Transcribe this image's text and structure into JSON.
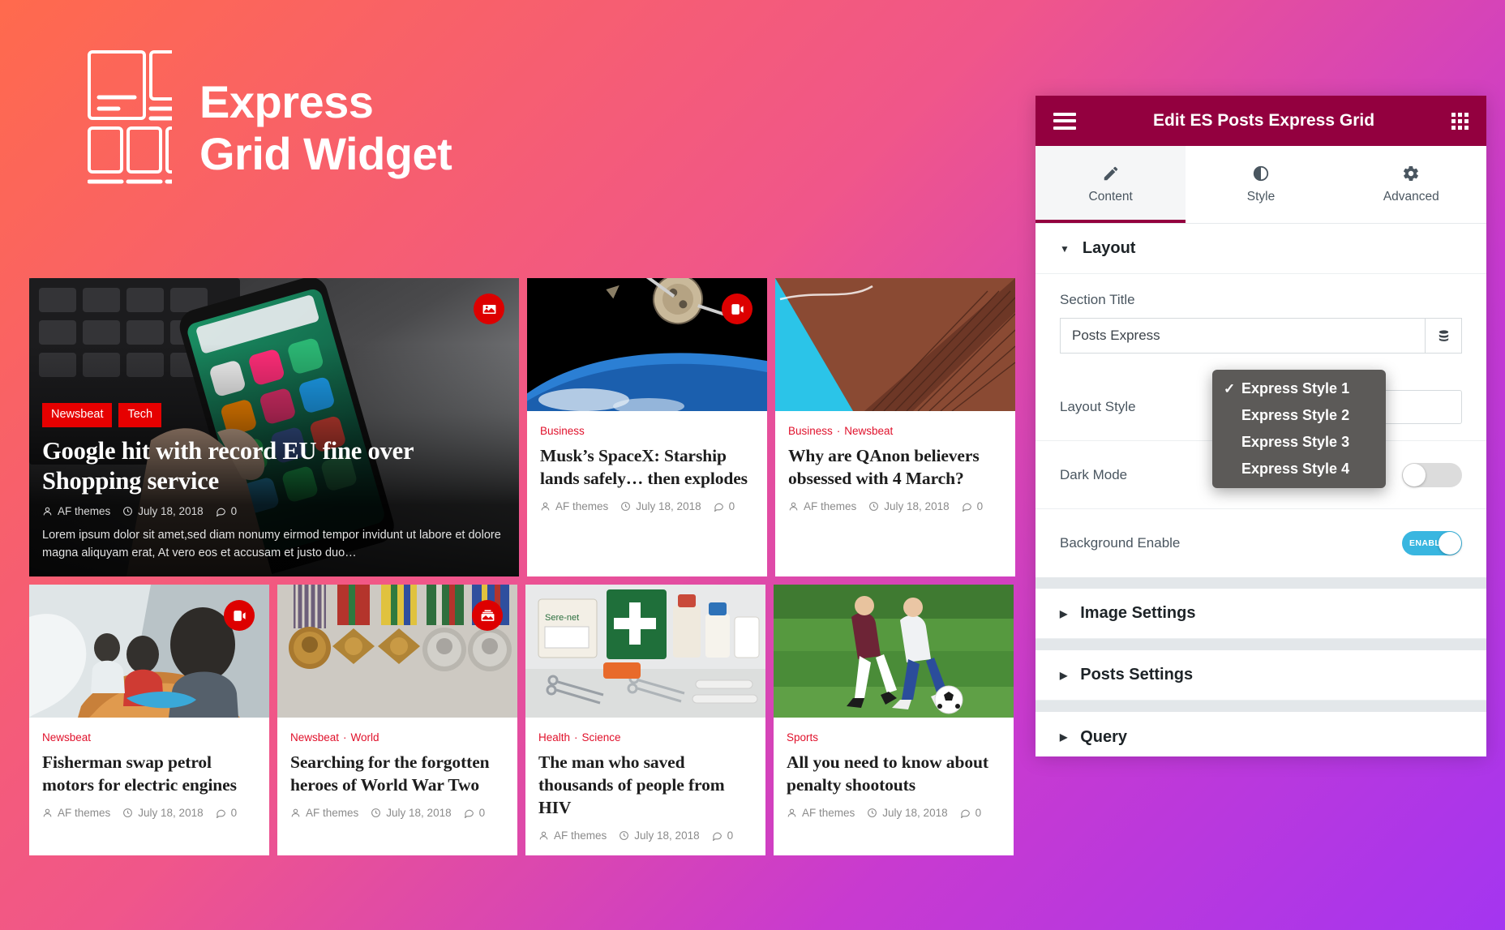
{
  "hero": {
    "title": "Express\nGrid Widget",
    "logo_icon": "grid-layout-icon"
  },
  "posts": {
    "featured": {
      "categories": [
        "Newsbeat",
        "Tech"
      ],
      "title": "Google hit with record EU fine over Shopping service",
      "author": "AF themes",
      "date": "July 18, 2018",
      "comments": "0",
      "excerpt": "Lorem ipsum dolor sit amet,sed diam nonumy eirmod tempor invidunt ut labore et dolore magna aliquyam erat, At vero eos et accusam et justo duo…",
      "badge_icon": "image-icon"
    },
    "cards": [
      {
        "categories": [
          "Business"
        ],
        "title": "Musk’s SpaceX: Starship lands safely… then explodes",
        "author": "AF themes",
        "date": "July 18, 2018",
        "comments": "0",
        "badge_icon": "video-icon"
      },
      {
        "categories": [
          "Business",
          "Newsbeat"
        ],
        "title": "Why are QAnon believers obsessed with 4 March?",
        "author": "AF themes",
        "date": "July 18, 2018",
        "comments": "0",
        "badge_icon": ""
      },
      {
        "categories": [
          "Newsbeat"
        ],
        "title": "Fisherman swap petrol motors for electric engines",
        "author": "AF themes",
        "date": "July 18, 2018",
        "comments": "0",
        "badge_icon": "video-icon"
      },
      {
        "categories": [
          "Newsbeat",
          "World"
        ],
        "title": "Searching for the forgotten heroes of World War Two",
        "author": "AF themes",
        "date": "July 18, 2018",
        "comments": "0",
        "badge_icon": "gallery-icon"
      },
      {
        "categories": [
          "Health",
          "Science"
        ],
        "title": "The man who saved thousands of people from HIV",
        "author": "AF themes",
        "date": "July 18, 2018",
        "comments": "0",
        "badge_icon": ""
      },
      {
        "categories": [
          "Sports"
        ],
        "title": "All you need to know about penalty shootouts",
        "author": "AF themes",
        "date": "July 18, 2018",
        "comments": "0",
        "badge_icon": ""
      }
    ]
  },
  "panel": {
    "header": {
      "menu_icon": "hamburger-icon",
      "title": "Edit ES Posts Express Grid",
      "apps_icon": "grid-dots-icon"
    },
    "tabs": [
      {
        "label": "Content",
        "icon": "pencil-icon",
        "active": true
      },
      {
        "label": "Style",
        "icon": "contrast-icon",
        "active": false
      },
      {
        "label": "Advanced",
        "icon": "gear-icon",
        "active": false
      }
    ],
    "sections": {
      "layout": {
        "title": "Layout",
        "caret": "▼",
        "section_title_label": "Section Title",
        "section_title_value": "Posts Express",
        "section_title_placeholder": "Posts Express",
        "dynamic_icon": "database-icon",
        "layout_style_label": "Layout Style",
        "dark_mode_label": "Dark Mode",
        "dark_mode_state": "off",
        "background_enable_label": "Background Enable",
        "background_enable_state": "ENABLE"
      },
      "collapsed": [
        {
          "title": "Image Settings",
          "caret": "▶"
        },
        {
          "title": "Posts Settings",
          "caret": "▶"
        },
        {
          "title": "Query",
          "caret": "▶"
        }
      ]
    },
    "dropdown": {
      "check_glyph": "✓",
      "options": [
        {
          "label": "Express Style 1",
          "selected": true
        },
        {
          "label": "Express Style 2",
          "selected": false
        },
        {
          "label": "Express Style 3",
          "selected": false
        },
        {
          "label": "Express Style 4",
          "selected": false
        }
      ]
    }
  },
  "colors": {
    "brand_maroon": "#93003f",
    "category_red": "#e0112b",
    "chip_red": "#e60000",
    "toggle_blue": "#39b6e0",
    "badge_red": "#d00000"
  }
}
